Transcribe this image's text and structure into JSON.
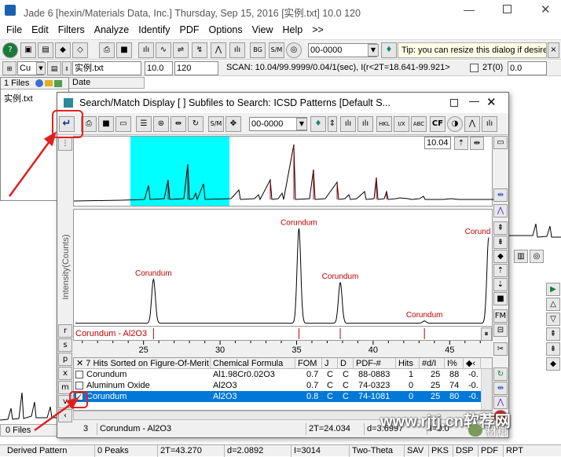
{
  "app": {
    "title": "Jade 6 [hexin/Materials Data, Inc.] Thursday, Sep 15, 2016 [实例.txt] 10.0     120",
    "menu": [
      "File",
      "Edit",
      "Filters",
      "Analyze",
      "Identify",
      "PDF",
      "Options",
      "View",
      "Help",
      ">>"
    ],
    "toolbar1": {
      "pdf_select": "00-0000",
      "tip": "Tip: you can resize this dialog if desired"
    },
    "toolbar2": {
      "element": "Cu",
      "file": "实例.txt",
      "val1": "10.0",
      "val2": "120",
      "scan": "SCAN: 10.04/99.9999/0.04/1(sec), I(r<2T=18.641-99.921>",
      "twotheta_label": "2T(0)",
      "twotheta_val": "0.0"
    },
    "left_panel": {
      "files_tab": "1 Files",
      "date_col": "Date",
      "file_item": "实例.txt",
      "files_count": "0 Files"
    },
    "status": {
      "mode": "Derived Pattern",
      "peaks": "0 Peaks",
      "twotheta": "2T=43.270",
      "d": "d=2.0892",
      "intensity": "I=3014",
      "axis": "Two-Theta",
      "buttons": [
        "SAV",
        "PKS",
        "DSP",
        "PDF",
        "RPT"
      ]
    }
  },
  "dialog": {
    "title": "Search/Match Display [ ] Subfiles to Search: ICSD Patterns [Default S...",
    "pdf_select": "00-0000",
    "range_start": "10.04",
    "ylabel": "Intensity(Counts)",
    "side_letters": [
      "r",
      "s",
      "p",
      "x",
      "m",
      "v"
    ],
    "right_label": "FM",
    "pattern_label": "Corundum - Al2O3",
    "table": {
      "header_title": "7 Hits Sorted on Figure-Of-Merit",
      "columns": [
        "Chemical Formula",
        "FOM",
        "J",
        "D",
        "PDF-#",
        "Hits",
        "#d/I",
        "I%"
      ],
      "rows": [
        {
          "checked": false,
          "name": "Corundum",
          "formula": "Al1.98Cr0.02O3",
          "fom": "0.7",
          "j": "C",
          "d": "C",
          "pdf": "88-0883",
          "hits": "1",
          "ndi": "25",
          "ipct": "88",
          "extra": "-0."
        },
        {
          "checked": false,
          "name": "Aluminum Oxide",
          "formula": "Al2O3",
          "fom": "0.7",
          "j": "C",
          "d": "C",
          "pdf": "74-0323",
          "hits": "0",
          "ndi": "25",
          "ipct": "74",
          "extra": "-0."
        },
        {
          "checked": true,
          "name": "Corundum",
          "formula": "Al2O3",
          "fom": "0.8",
          "j": "C",
          "d": "C",
          "pdf": "74-1081",
          "hits": "0",
          "ndi": "25",
          "ipct": "80",
          "extra": "-0."
        }
      ]
    },
    "status": {
      "count": "3",
      "phase": "Corundum - Al2O3",
      "twotheta": "2T=24.034",
      "d": "d=3.6997",
      "i": "I=0.0"
    }
  },
  "watermark": {
    "url": "www.rjtj.cn软荐网",
    "brand": "材料"
  },
  "chart_data": {
    "type": "line",
    "title": "",
    "xlabel": "",
    "ylabel": "Intensity(Counts)",
    "xlim": [
      20.5,
      47.5
    ],
    "xticks": [
      25,
      30,
      35,
      40,
      45
    ],
    "peaks": [
      {
        "x": 25.6,
        "h": 0.4,
        "label": "Corundum"
      },
      {
        "x": 35.1,
        "h": 0.86,
        "label": "Corundum"
      },
      {
        "x": 37.8,
        "h": 0.37,
        "label": "Corundum"
      },
      {
        "x": 43.3,
        "h": 0.02,
        "label": "Corundum"
      },
      {
        "x": 47.5,
        "h": 0.78,
        "label": "Corund"
      }
    ]
  }
}
